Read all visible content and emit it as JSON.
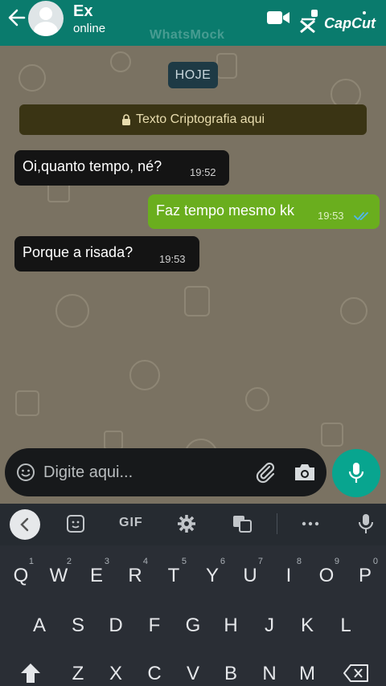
{
  "header": {
    "contact_name": "Ex",
    "status": "online",
    "watermark": "WhatsMock",
    "capcut_label": "CapCut"
  },
  "chat": {
    "date_chip": "HOJE",
    "crypto_notice": "Texto Criptografia aqui",
    "messages": [
      {
        "direction": "in",
        "text": "Oi,quanto tempo, né?",
        "time": "19:52"
      },
      {
        "direction": "out",
        "text": "Faz tempo mesmo kk",
        "time": "19:53",
        "ticks": "read"
      },
      {
        "direction": "in",
        "text": "Porque a risada?",
        "time": "19:53"
      }
    ]
  },
  "composer": {
    "placeholder": "Digite aqui..."
  },
  "keyboard": {
    "toolbar_gif_label": "GIF",
    "row1": [
      {
        "key": "Q",
        "hint": "1"
      },
      {
        "key": "W",
        "hint": "2"
      },
      {
        "key": "E",
        "hint": "3"
      },
      {
        "key": "R",
        "hint": "4"
      },
      {
        "key": "T",
        "hint": "5"
      },
      {
        "key": "Y",
        "hint": "6"
      },
      {
        "key": "U",
        "hint": "7"
      },
      {
        "key": "I",
        "hint": "8"
      },
      {
        "key": "O",
        "hint": "9"
      },
      {
        "key": "P",
        "hint": "0"
      }
    ],
    "row2": [
      "A",
      "S",
      "D",
      "F",
      "G",
      "H",
      "J",
      "K",
      "L"
    ],
    "row3": [
      "Z",
      "X",
      "C",
      "V",
      "B",
      "N",
      "M"
    ]
  },
  "colors": {
    "header": "#0a7b6d",
    "outgoing_bubble": "#6aae1e",
    "incoming_bubble": "#141414",
    "mic_button": "#08a58f",
    "read_ticks": "#4fb6ec"
  }
}
